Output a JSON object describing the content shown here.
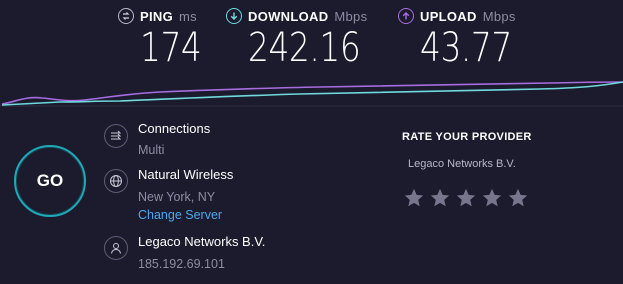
{
  "metrics": {
    "ping": {
      "label": "PING",
      "unit": "ms",
      "value": "174",
      "icon": "ping-icon"
    },
    "download": {
      "label": "DOWNLOAD",
      "unit": "Mbps",
      "value": "242.16",
      "icon": "download-arrow-icon"
    },
    "upload": {
      "label": "UPLOAD",
      "unit": "Mbps",
      "value": "43.77",
      "icon": "upload-arrow-icon"
    }
  },
  "colors": {
    "background": "#1c1b2e",
    "download": "#6fd9dc",
    "upload": "#a76ce0",
    "accent": "#1fa8b8",
    "link": "#4aa8ef",
    "muted": "#8d8ca2"
  },
  "go_button": {
    "label": "GO"
  },
  "connections": {
    "title": "Connections",
    "value": "Multi",
    "icon": "connections-arrows-icon"
  },
  "server": {
    "title": "Natural Wireless",
    "location": "New York, NY",
    "change_label": "Change Server",
    "icon": "globe-icon"
  },
  "provider": {
    "title": "Legaco Networks B.V.",
    "ip": "185.192.69.101",
    "icon": "user-icon"
  },
  "rating": {
    "title": "RATE YOUR PROVIDER",
    "provider_name": "Legaco Networks B.V.",
    "stars_total": 5,
    "stars_selected": 0
  }
}
